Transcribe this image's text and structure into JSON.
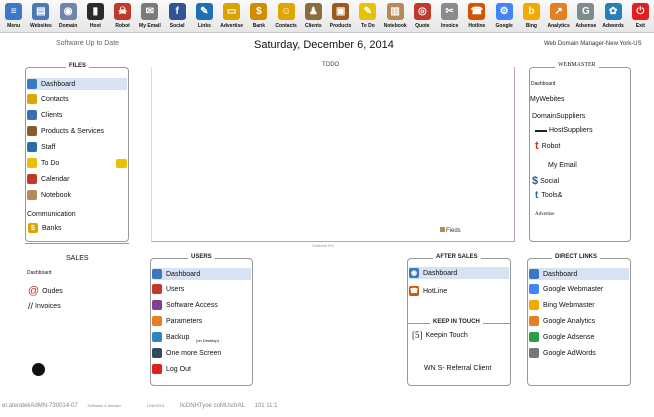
{
  "toolbar": {
    "items": [
      {
        "label": "Menu",
        "icon": "menu-icon",
        "color": "#3d78c8",
        "glyph": "≡"
      },
      {
        "label": "Websites",
        "icon": "websites-icon",
        "color": "#4a79b5",
        "glyph": "▤"
      },
      {
        "label": "Domain",
        "icon": "domain-icon",
        "color": "#6f86a8",
        "glyph": "◉"
      },
      {
        "label": "Host",
        "icon": "host-icon",
        "color": "#2b2b2b",
        "glyph": "▮"
      },
      {
        "label": "Robot",
        "icon": "robot-icon",
        "color": "#c0392b",
        "glyph": "☠"
      },
      {
        "label": "My Email",
        "icon": "email-icon",
        "color": "#7a7a7a",
        "glyph": "✉"
      },
      {
        "label": "Social",
        "icon": "social-icon",
        "color": "#2f5597",
        "glyph": "f"
      },
      {
        "label": "Links",
        "icon": "links-icon",
        "color": "#1f6fb5",
        "glyph": "✎"
      },
      {
        "label": "Advertise",
        "icon": "advertise-icon",
        "color": "#d9a400",
        "glyph": "▭"
      },
      {
        "label": "Bank",
        "icon": "bank-icon",
        "color": "#d48c00",
        "glyph": "$"
      },
      {
        "label": "Contacts",
        "icon": "contacts-icon",
        "color": "#e0a500",
        "glyph": "☺"
      },
      {
        "label": "Clients",
        "icon": "clients-icon",
        "color": "#8a6d3b",
        "glyph": "♟"
      },
      {
        "label": "Products",
        "icon": "products-icon",
        "color": "#9c5a1c",
        "glyph": "▣"
      },
      {
        "label": "To Do",
        "icon": "todo-icon",
        "color": "#e8c200",
        "glyph": "✎"
      },
      {
        "label": "Notebook",
        "icon": "notebook-icon",
        "color": "#b58b5a",
        "glyph": "▥"
      },
      {
        "label": "Quote",
        "icon": "quote-icon",
        "color": "#c0392b",
        "glyph": "◎"
      },
      {
        "label": "Invoice",
        "icon": "invoice-icon",
        "color": "#8b8b8b",
        "glyph": "✂"
      },
      {
        "label": "Hotline",
        "icon": "hotline-icon",
        "color": "#d35400",
        "glyph": "☎"
      },
      {
        "label": "Google",
        "icon": "google-icon",
        "color": "#4285f4",
        "glyph": "⚙"
      },
      {
        "label": "Bing",
        "icon": "bing-icon",
        "color": "#f2a900",
        "glyph": "b"
      },
      {
        "label": "Analytics",
        "icon": "analytics-icon",
        "color": "#e67e22",
        "glyph": "↗"
      },
      {
        "label": "Adsense",
        "icon": "adsense-icon",
        "color": "#7f8c8d",
        "glyph": "G"
      },
      {
        "label": "Adwords",
        "icon": "adwords-icon",
        "color": "#2980b9",
        "glyph": "✿"
      },
      {
        "label": "Exit",
        "icon": "exit-icon",
        "color": "#e02020",
        "glyph": "⏻"
      }
    ]
  },
  "status": {
    "left": "Software Up to Date",
    "date": "Saturday, December  6, 2014",
    "right": "Web Domain Manager-New York-US"
  },
  "files": {
    "title": "FILES",
    "items": [
      {
        "label": "Dashboard",
        "icon": "dashboard-icon",
        "color": "#3a78c0"
      },
      {
        "label": "Contacts",
        "icon": "contacts-icon",
        "color": "#e0a500"
      },
      {
        "label": "Clients",
        "icon": "clients-icon",
        "color": "#3b6fb5"
      },
      {
        "label": "Products & Services",
        "icon": "products-icon",
        "color": "#8a5a2b"
      },
      {
        "label": "Staff",
        "icon": "staff-icon",
        "color": "#2e6da4"
      },
      {
        "label": "To Do",
        "icon": "todo-icon",
        "color": "#e8c200"
      },
      {
        "label": "Calendar",
        "icon": "calendar-icon",
        "color": "#c0392b"
      },
      {
        "label": "Notebook",
        "icon": "notebook-icon",
        "color": "#b58b5a"
      }
    ],
    "communication": "Communication",
    "banks": "Banks"
  },
  "todo": {
    "title": "TODO",
    "fieds": "Fieds",
    "foot": "Subtotal 0%"
  },
  "webmaster": {
    "title": "WEBMASTER",
    "dashboard": "Dashboard",
    "my_websites": "MyWebites",
    "domain_suppliers": "DomainSuppliers",
    "host_suppliers": "HostSuppliers",
    "robot": "Robot",
    "my_email": "My Email",
    "social": "Social",
    "tools": "Tools&",
    "advertise": "Advertise"
  },
  "sales": {
    "title": "SALES",
    "dashboard": "Dashboard",
    "quotes": "Oudes",
    "invoices": "Invoices"
  },
  "users": {
    "title": "USERS",
    "items": [
      {
        "label": "Dashboard",
        "icon": "dashboard-icon",
        "color": "#3a78c0"
      },
      {
        "label": "Users",
        "icon": "users-icon",
        "color": "#c0392b"
      },
      {
        "label": "Software Access",
        "icon": "access-icon",
        "color": "#7f3f98"
      },
      {
        "label": "Parameters",
        "icon": "parameters-icon",
        "color": "#e67e22"
      },
      {
        "label": "Backup",
        "icon": "backup-icon",
        "color": "#2e86c1"
      },
      {
        "label": "One more Screen",
        "icon": "screen-icon",
        "color": "#34495e"
      },
      {
        "label": "Log Out",
        "icon": "logout-icon",
        "color": "#e02020"
      }
    ],
    "backup_note": "(on Desktop)"
  },
  "after_sales": {
    "title": "AFTER SALES",
    "dashboard": "Dashboard",
    "hotline": "HotLine"
  },
  "keep_in_touch": {
    "title": "KEEP IN TOUCH",
    "keep": "Keepin Touch",
    "referral": "WN S- Referral Client"
  },
  "direct_links": {
    "title": "DIRECT LINKS",
    "items": [
      {
        "label": "Dashboard",
        "icon": "dashboard-icon",
        "color": "#3a78c0"
      },
      {
        "label": "Google Webmaster",
        "icon": "google-icon",
        "color": "#4285f4"
      },
      {
        "label": "Bing Webmaster",
        "icon": "bing-icon",
        "color": "#f2a900"
      },
      {
        "label": "Google Analytics",
        "icon": "analytics-icon",
        "color": "#e67e22"
      },
      {
        "label": "Google Adsense",
        "icon": "adsense-icon",
        "color": "#2c9f45"
      },
      {
        "label": "Google AdWords",
        "icon": "adwords-icon",
        "color": "#777777"
      }
    ]
  },
  "bottom_status": {
    "text1": "er.ateratekAdMN-730014-07",
    "text2": "Software 4 domain",
    "text3": "12/6/2014",
    "text4": "IlcDNHTyoe coMUsdrAL",
    "text5": "101 11:1"
  }
}
